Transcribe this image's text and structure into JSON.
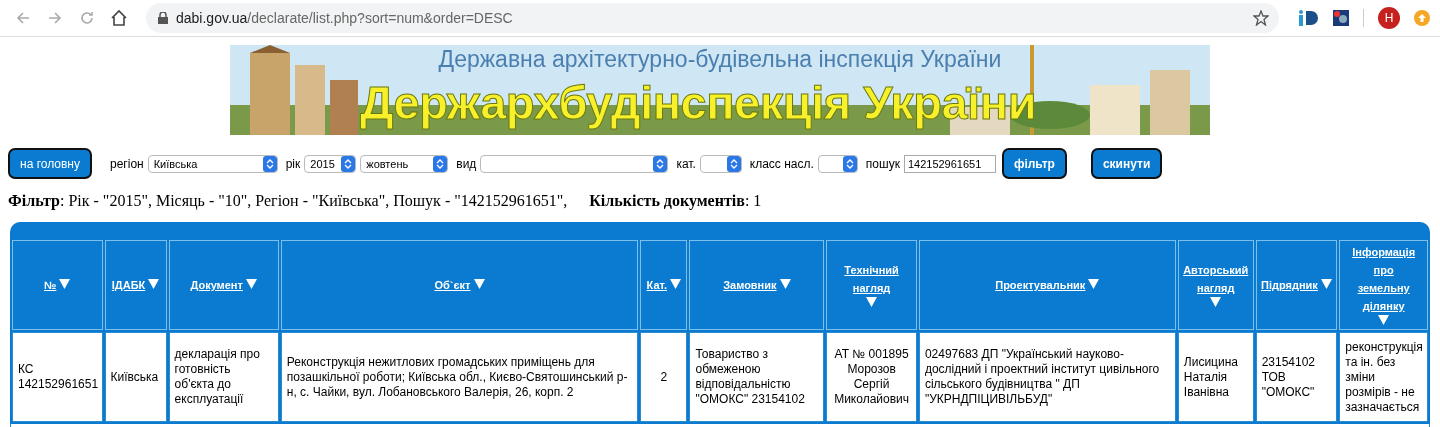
{
  "browser": {
    "url_host": "dabi.gov.ua",
    "url_path": "/declarate/list.php?sort=num&order=DESC",
    "avatar": "H"
  },
  "banner": {
    "subtitle": "Державна архітектурно-будівельна інспекція України",
    "title": "Держархбудінспекція України"
  },
  "toolbar": {
    "home_button": "на головну",
    "fields": [
      {
        "kind": "select",
        "label": "регіон",
        "value": "Київська"
      },
      {
        "kind": "select",
        "label": "рік",
        "value": "2015"
      },
      {
        "kind": "select",
        "value": "жовтень"
      },
      {
        "kind": "select",
        "label": "вид"
      },
      {
        "kind": "select",
        "label": "кат."
      },
      {
        "kind": "select",
        "label": "класс насл."
      },
      {
        "kind": "text",
        "label": "пошук",
        "value": "142152961651"
      }
    ],
    "filter_button": "фільтр",
    "reset_button": "скинути"
  },
  "filter_summary": "**Фільтр**: Рік - \"2015\", Місяць - \"10\", Регіон - \"Київська\", Пошук - \"142152961651\",",
  "document_count": "**Кількість документів**: 1",
  "table": {
    "columns": [
      "№",
      "ІДАБК",
      "Документ",
      "Об`єкт",
      "Кат.",
      "Замовник",
      "Технічний нагляд",
      "Проектувальник",
      "Авторський нагляд",
      "Підрядник",
      "Інформація про земельну ділянку"
    ],
    "rows": [
      [
        "КС 142152961651",
        "Київська",
        "декларація про готовність об'єкта до експлуатації",
        "Реконструкція нежитлових громадських приміщень для позашкільної роботи; Київська обл., Києво-Святошинський р-н, с. Чайки, вул. Лобановського Валерія, 26, корп. 2",
        "2",
        "Товариство з обмеженою відповідальністю \"ОМОКС\" 23154102",
        "АТ № 001895 Морозов Сергій Миколайович",
        "02497683 ДП \"Український науково-дослідний і проектний інститут цивільного сільського будівництва \" ДП \"УКРНДПІЦИВІЛЬБУД\"",
        "Лисицина Наталія Іванівна",
        "23154102 ТОВ \"ОМОКС\"",
        "реконструкція та ін. без зміни розмірів - не зазначається"
      ]
    ]
  }
}
